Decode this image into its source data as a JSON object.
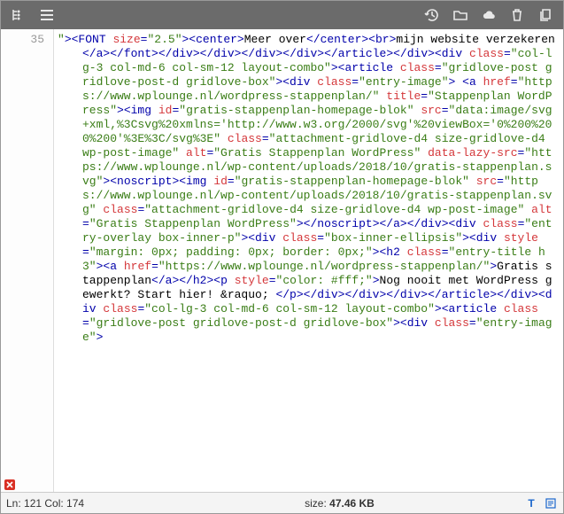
{
  "toolbar": {
    "icons": {
      "tree": "tree-toggle-icon",
      "menu": "menu-icon",
      "history": "history-icon",
      "folder": "folder-icon",
      "cloud": "cloud-download-icon",
      "trash": "trash-icon",
      "copy": "copy-icon"
    }
  },
  "gutter": {
    "line": "35"
  },
  "code": {
    "tokens": [
      {
        "t": "attr-val",
        "v": "\""
      },
      {
        "t": "punc",
        "v": "><"
      },
      {
        "t": "tag",
        "v": "FONT"
      },
      {
        "t": "txt",
        "v": " "
      },
      {
        "t": "attr-name",
        "v": "size"
      },
      {
        "t": "punc",
        "v": "="
      },
      {
        "t": "attr-val",
        "v": "\"2.5\""
      },
      {
        "t": "punc",
        "v": "><"
      },
      {
        "t": "tag",
        "v": "center"
      },
      {
        "t": "punc",
        "v": ">"
      },
      {
        "t": "txt",
        "v": "Meer over"
      },
      {
        "t": "punc",
        "v": "</"
      },
      {
        "t": "tag",
        "v": "center"
      },
      {
        "t": "punc",
        "v": "><"
      },
      {
        "t": "tag",
        "v": "br"
      },
      {
        "t": "punc",
        "v": ">"
      },
      {
        "t": "txt",
        "v": "mijn website verzekeren"
      },
      {
        "t": "punc",
        "v": "</"
      },
      {
        "t": "tag",
        "v": "a"
      },
      {
        "t": "punc",
        "v": "></"
      },
      {
        "t": "tag",
        "v": "font"
      },
      {
        "t": "punc",
        "v": "></"
      },
      {
        "t": "tag",
        "v": "div"
      },
      {
        "t": "punc",
        "v": "></"
      },
      {
        "t": "tag",
        "v": "div"
      },
      {
        "t": "punc",
        "v": "></"
      },
      {
        "t": "tag",
        "v": "div"
      },
      {
        "t": "punc",
        "v": "></"
      },
      {
        "t": "tag",
        "v": "div"
      },
      {
        "t": "punc",
        "v": "></"
      },
      {
        "t": "tag",
        "v": "article"
      },
      {
        "t": "punc",
        "v": "></"
      },
      {
        "t": "tag",
        "v": "div"
      },
      {
        "t": "punc",
        "v": "><"
      },
      {
        "t": "tag",
        "v": "div"
      },
      {
        "t": "txt",
        "v": " "
      },
      {
        "t": "attr-name",
        "v": "class"
      },
      {
        "t": "punc",
        "v": "="
      },
      {
        "t": "attr-val",
        "v": "\"col-lg-3 col-md-6 col-sm-12 layout-combo\""
      },
      {
        "t": "punc",
        "v": "><"
      },
      {
        "t": "tag",
        "v": "article"
      },
      {
        "t": "txt",
        "v": " "
      },
      {
        "t": "attr-name",
        "v": "class"
      },
      {
        "t": "punc",
        "v": "="
      },
      {
        "t": "attr-val",
        "v": "\"gridlove-post gridlove-post-d gridlove-box\""
      },
      {
        "t": "punc",
        "v": "><"
      },
      {
        "t": "tag",
        "v": "div"
      },
      {
        "t": "txt",
        "v": " "
      },
      {
        "t": "attr-name",
        "v": "class"
      },
      {
        "t": "punc",
        "v": "="
      },
      {
        "t": "attr-val",
        "v": "\"entry-image\""
      },
      {
        "t": "punc",
        "v": ">"
      },
      {
        "t": "txt",
        "v": " "
      },
      {
        "t": "punc",
        "v": "<"
      },
      {
        "t": "tag",
        "v": "a"
      },
      {
        "t": "txt",
        "v": " "
      },
      {
        "t": "attr-name",
        "v": "href"
      },
      {
        "t": "punc",
        "v": "="
      },
      {
        "t": "attr-val",
        "v": "\"https://www.wplounge.nl/wordpress-stappenplan/\""
      },
      {
        "t": "txt",
        "v": " "
      },
      {
        "t": "attr-name",
        "v": "title"
      },
      {
        "t": "punc",
        "v": "="
      },
      {
        "t": "attr-val",
        "v": "\"Stappenplan WordPress\""
      },
      {
        "t": "punc",
        "v": "><"
      },
      {
        "t": "tag",
        "v": "img"
      },
      {
        "t": "txt",
        "v": " "
      },
      {
        "t": "attr-name",
        "v": "id"
      },
      {
        "t": "punc",
        "v": "="
      },
      {
        "t": "attr-val",
        "v": "\"gratis-stappenplan-homepage-blok\""
      },
      {
        "t": "txt",
        "v": " "
      },
      {
        "t": "attr-name",
        "v": "src"
      },
      {
        "t": "punc",
        "v": "="
      },
      {
        "t": "attr-val",
        "v": "\"data:image/svg+xml,%3Csvg%20xmlns='http://www.w3.org/2000/svg'%20viewBox='0%200%200%200'%3E%3C/svg%3E\""
      },
      {
        "t": "txt",
        "v": " "
      },
      {
        "t": "attr-name",
        "v": "class"
      },
      {
        "t": "punc",
        "v": "="
      },
      {
        "t": "attr-val",
        "v": "\"attachment-gridlove-d4 size-gridlove-d4 wp-post-image\""
      },
      {
        "t": "txt",
        "v": " "
      },
      {
        "t": "attr-name",
        "v": "alt"
      },
      {
        "t": "punc",
        "v": "="
      },
      {
        "t": "attr-val",
        "v": "\"Gratis Stappenplan WordPress\""
      },
      {
        "t": "txt",
        "v": " "
      },
      {
        "t": "attr-name",
        "v": "data-lazy-src"
      },
      {
        "t": "punc",
        "v": "="
      },
      {
        "t": "attr-val",
        "v": "\"https://www.wplounge.nl/wp-content/uploads/2018/10/gratis-stappenplan.svg\""
      },
      {
        "t": "punc",
        "v": "><"
      },
      {
        "t": "tag",
        "v": "noscript"
      },
      {
        "t": "punc",
        "v": "><"
      },
      {
        "t": "tag",
        "v": "img"
      },
      {
        "t": "txt",
        "v": " "
      },
      {
        "t": "attr-name",
        "v": "id"
      },
      {
        "t": "punc",
        "v": "="
      },
      {
        "t": "attr-val",
        "v": "\"gratis-stappenplan-homepage-blok\""
      },
      {
        "t": "txt",
        "v": " "
      },
      {
        "t": "attr-name",
        "v": "src"
      },
      {
        "t": "punc",
        "v": "="
      },
      {
        "t": "attr-val",
        "v": "\"https://www.wplounge.nl/wp-content/uploads/2018/10/gratis-stappenplan.svg\""
      },
      {
        "t": "txt",
        "v": " "
      },
      {
        "t": "attr-name",
        "v": "class"
      },
      {
        "t": "punc",
        "v": "="
      },
      {
        "t": "attr-val",
        "v": "\"attachment-gridlove-d4 size-gridlove-d4 wp-post-image\""
      },
      {
        "t": "txt",
        "v": " "
      },
      {
        "t": "attr-name",
        "v": "alt"
      },
      {
        "t": "punc",
        "v": "="
      },
      {
        "t": "attr-val",
        "v": "\"Gratis Stappenplan WordPress\""
      },
      {
        "t": "punc",
        "v": "></"
      },
      {
        "t": "tag",
        "v": "noscript"
      },
      {
        "t": "punc",
        "v": "></"
      },
      {
        "t": "tag",
        "v": "a"
      },
      {
        "t": "punc",
        "v": "></"
      },
      {
        "t": "tag",
        "v": "div"
      },
      {
        "t": "punc",
        "v": "><"
      },
      {
        "t": "tag",
        "v": "div"
      },
      {
        "t": "txt",
        "v": " "
      },
      {
        "t": "attr-name",
        "v": "class"
      },
      {
        "t": "punc",
        "v": "="
      },
      {
        "t": "attr-val",
        "v": "\"entry-overlay box-inner-p\""
      },
      {
        "t": "punc",
        "v": "><"
      },
      {
        "t": "tag",
        "v": "div"
      },
      {
        "t": "txt",
        "v": " "
      },
      {
        "t": "attr-name",
        "v": "class"
      },
      {
        "t": "punc",
        "v": "="
      },
      {
        "t": "attr-val",
        "v": "\"box-inner-ellipsis\""
      },
      {
        "t": "punc",
        "v": "><"
      },
      {
        "t": "tag",
        "v": "div"
      },
      {
        "t": "txt",
        "v": " "
      },
      {
        "t": "attr-name",
        "v": "style"
      },
      {
        "t": "punc",
        "v": "="
      },
      {
        "t": "attr-val",
        "v": "\"margin: 0px; padding: 0px; border: 0px;\""
      },
      {
        "t": "punc",
        "v": "><"
      },
      {
        "t": "tag",
        "v": "h2"
      },
      {
        "t": "txt",
        "v": " "
      },
      {
        "t": "attr-name",
        "v": "class"
      },
      {
        "t": "punc",
        "v": "="
      },
      {
        "t": "attr-val",
        "v": "\"entry-title h3\""
      },
      {
        "t": "punc",
        "v": "><"
      },
      {
        "t": "tag",
        "v": "a"
      },
      {
        "t": "txt",
        "v": " "
      },
      {
        "t": "attr-name",
        "v": "href"
      },
      {
        "t": "punc",
        "v": "="
      },
      {
        "t": "attr-val",
        "v": "\"https://www.wplounge.nl/wordpress-stappenplan/\""
      },
      {
        "t": "punc",
        "v": ">"
      },
      {
        "t": "txt",
        "v": "Gratis stappenplan"
      },
      {
        "t": "punc",
        "v": "</"
      },
      {
        "t": "tag",
        "v": "a"
      },
      {
        "t": "punc",
        "v": "></"
      },
      {
        "t": "tag",
        "v": "h2"
      },
      {
        "t": "punc",
        "v": "><"
      },
      {
        "t": "tag",
        "v": "p"
      },
      {
        "t": "txt",
        "v": " "
      },
      {
        "t": "attr-name",
        "v": "style"
      },
      {
        "t": "punc",
        "v": "="
      },
      {
        "t": "attr-val",
        "v": "\"color: #fff;\""
      },
      {
        "t": "punc",
        "v": ">"
      },
      {
        "t": "txt",
        "v": "Nog nooit met WordPress gewerkt? Start hier! &raquo; "
      },
      {
        "t": "punc",
        "v": "</"
      },
      {
        "t": "tag",
        "v": "p"
      },
      {
        "t": "punc",
        "v": "></"
      },
      {
        "t": "tag",
        "v": "div"
      },
      {
        "t": "punc",
        "v": "></"
      },
      {
        "t": "tag",
        "v": "div"
      },
      {
        "t": "punc",
        "v": "></"
      },
      {
        "t": "tag",
        "v": "div"
      },
      {
        "t": "punc",
        "v": "></"
      },
      {
        "t": "tag",
        "v": "article"
      },
      {
        "t": "punc",
        "v": "></"
      },
      {
        "t": "tag",
        "v": "div"
      },
      {
        "t": "punc",
        "v": "><"
      },
      {
        "t": "tag",
        "v": "div"
      },
      {
        "t": "txt",
        "v": " "
      },
      {
        "t": "attr-name",
        "v": "class"
      },
      {
        "t": "punc",
        "v": "="
      },
      {
        "t": "attr-val",
        "v": "\"col-lg-3 col-md-6 col-sm-12 layout-combo\""
      },
      {
        "t": "punc",
        "v": "><"
      },
      {
        "t": "tag",
        "v": "article"
      },
      {
        "t": "txt",
        "v": " "
      },
      {
        "t": "attr-name",
        "v": "class"
      },
      {
        "t": "punc",
        "v": "="
      },
      {
        "t": "attr-val",
        "v": "\"gridlove-post gridlove-post-d gridlove-box\""
      },
      {
        "t": "punc",
        "v": "><"
      },
      {
        "t": "tag",
        "v": "div"
      },
      {
        "t": "txt",
        "v": " "
      },
      {
        "t": "attr-name",
        "v": "class"
      },
      {
        "t": "punc",
        "v": "="
      },
      {
        "t": "attr-val",
        "v": "\"entry-image\""
      },
      {
        "t": "punc",
        "v": ">"
      }
    ]
  },
  "footer": {
    "position": "Ln: 121 Col: 174",
    "size_label": "size: ",
    "size_value": "47.46 KB"
  }
}
